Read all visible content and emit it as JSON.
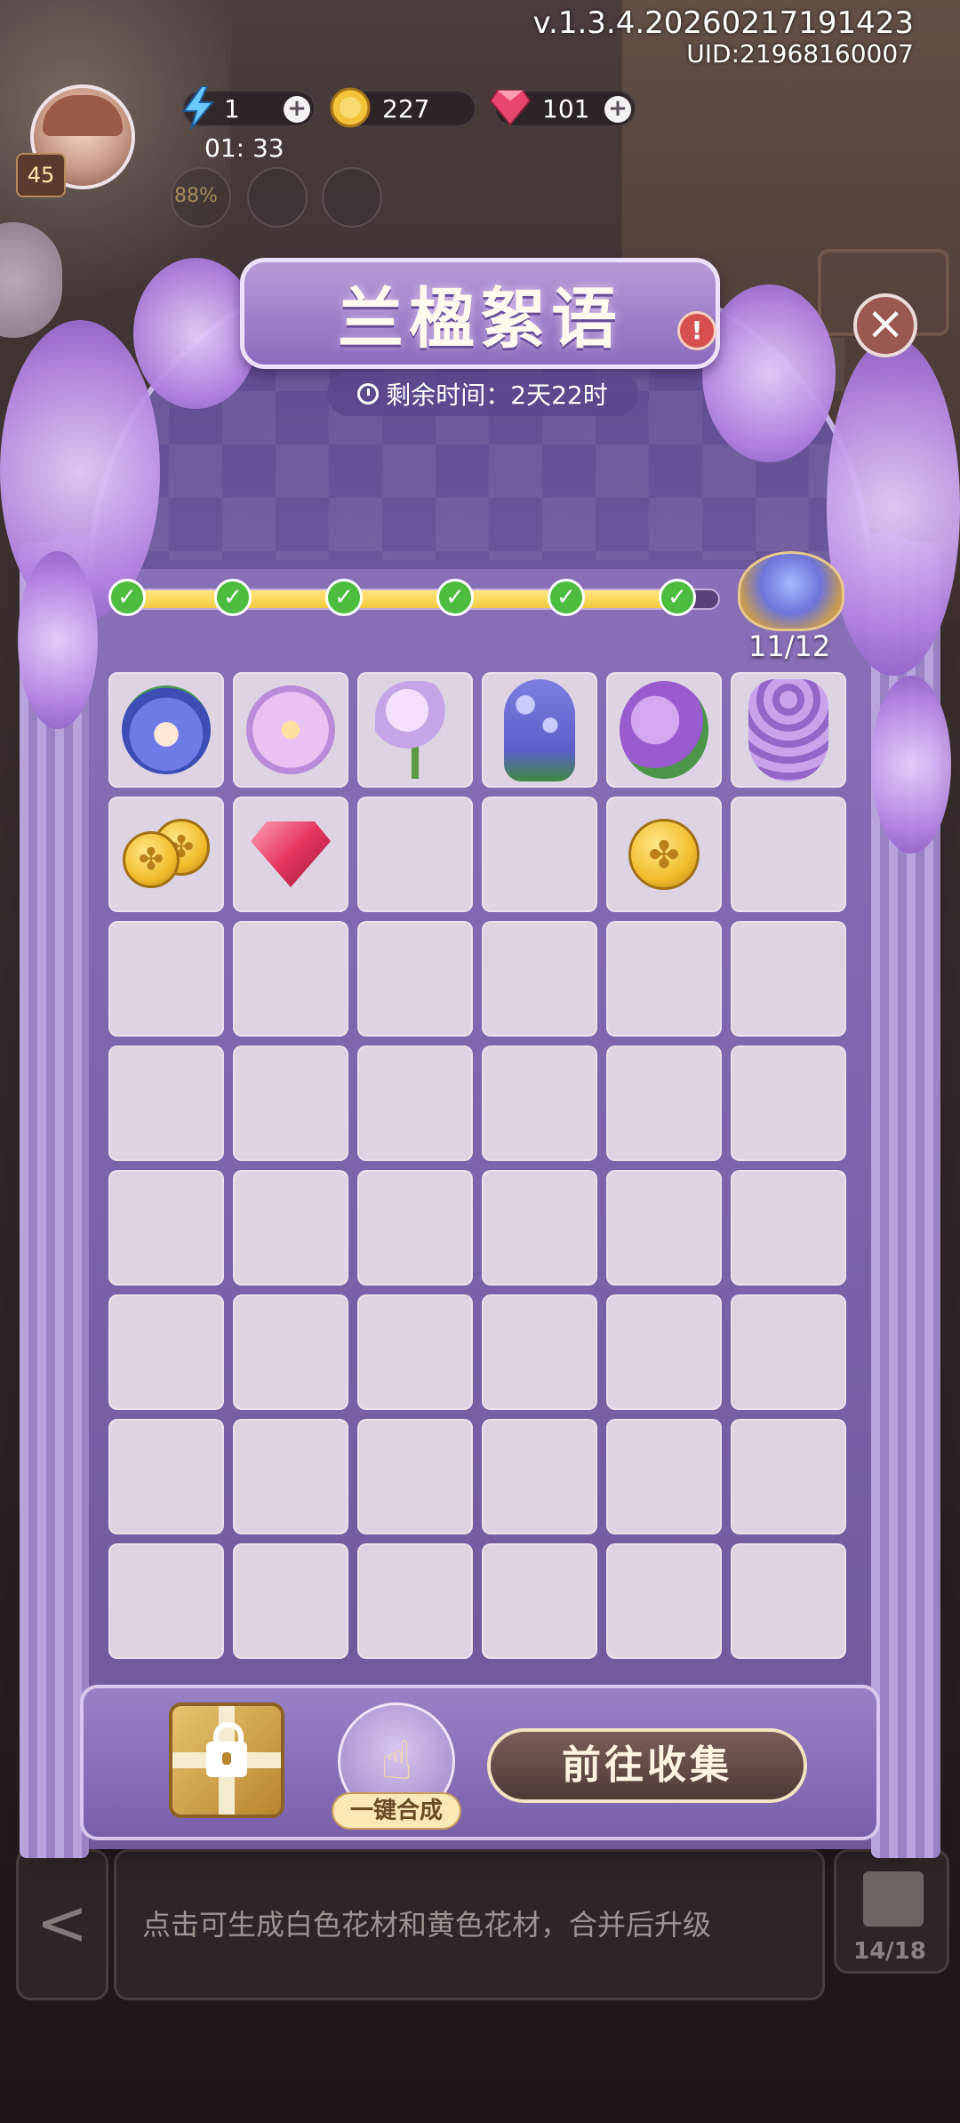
{
  "hud": {
    "version": "v.1.3.4.20260217191423",
    "uid": "UID:21968160007",
    "player_level": "45",
    "energy": "1",
    "gold": "227",
    "gems": "101",
    "timer": "01: 33",
    "faded_percent": "88%"
  },
  "event": {
    "title": "兰楹絮语",
    "time_left": "剩余时间：2天22时",
    "progress_text": "11/12",
    "progress": 0.92,
    "milestones_done": 6
  },
  "grid": {
    "rows": 8,
    "cols": 6,
    "items": [
      {
        "row": 0,
        "col": 0,
        "icon": "blue-lotus-icon"
      },
      {
        "row": 0,
        "col": 1,
        "icon": "lily-flower-icon"
      },
      {
        "row": 0,
        "col": 2,
        "icon": "freesia-flower-icon"
      },
      {
        "row": 0,
        "col": 3,
        "icon": "hyacinth-flower-icon"
      },
      {
        "row": 0,
        "col": 4,
        "icon": "violet-flower-icon"
      },
      {
        "row": 0,
        "col": 5,
        "icon": "wisteria-flower-icon"
      },
      {
        "row": 1,
        "col": 0,
        "icon": "gold-coins-icon"
      },
      {
        "row": 1,
        "col": 1,
        "icon": "red-gem-icon"
      },
      {
        "row": 1,
        "col": 4,
        "icon": "gold-coin-icon"
      }
    ]
  },
  "actions": {
    "merge_label": "一键合成",
    "collect_label": "前往收集"
  },
  "underlying": {
    "hint": "点击可生成白色花材和黄色花材，合并后升级",
    "storage_count": "14/18",
    "back_symbol": "<"
  },
  "colors": {
    "panel": "#7c63aa",
    "accent": "#f1c93c",
    "check": "#4cbd3e"
  }
}
